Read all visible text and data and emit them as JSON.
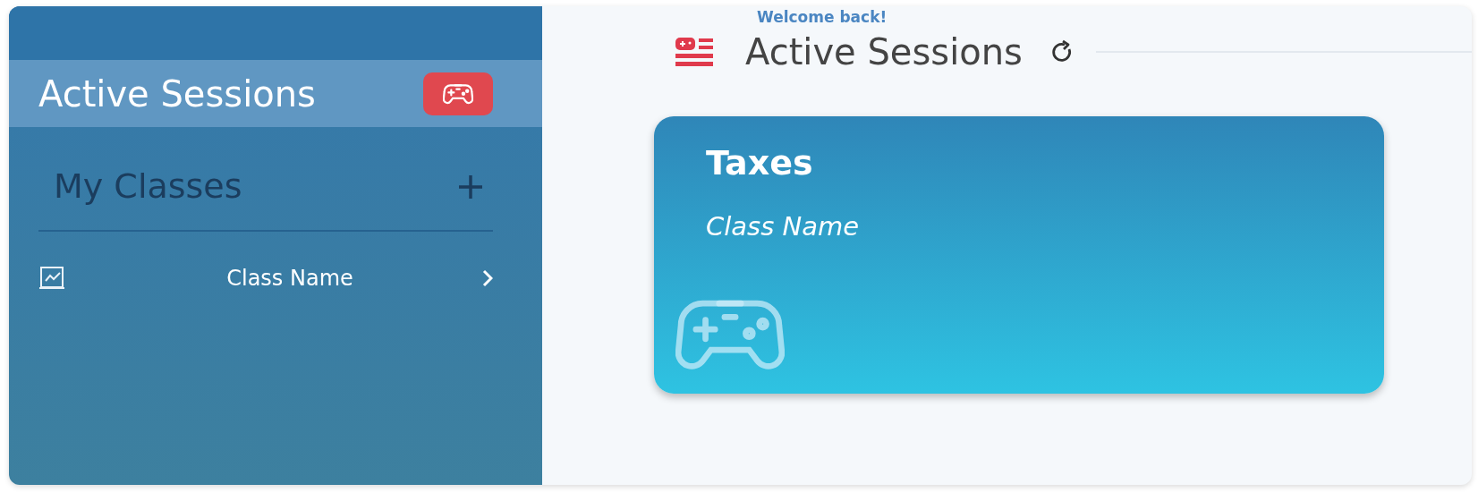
{
  "sidebar": {
    "nav_items": [
      {
        "label": "Active Sessions",
        "selected": true
      }
    ],
    "section": {
      "title": "My Classes"
    },
    "classes": [
      {
        "label": "Class Name",
        "selected": false
      }
    ]
  },
  "header": {
    "greeting": "Welcome back!",
    "title": "Active Sessions"
  },
  "sessions": [
    {
      "title": "Taxes",
      "subtitle": "Class Name"
    }
  ]
}
